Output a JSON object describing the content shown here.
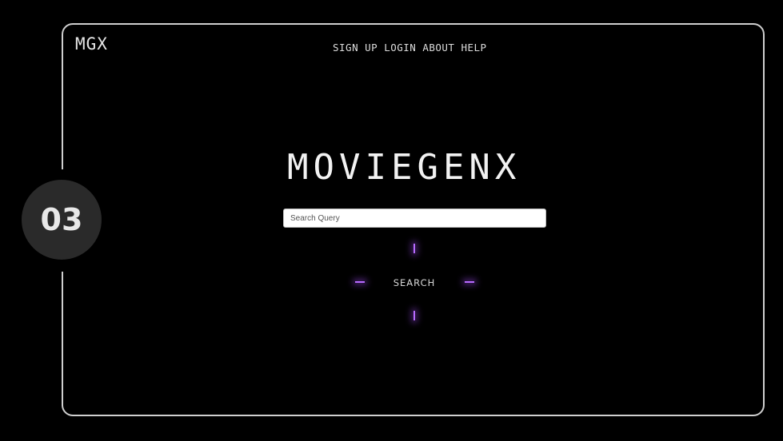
{
  "step_badge": "03",
  "header": {
    "logo": "MGX",
    "nav": {
      "sign_up": "SIGN UP",
      "login": "LOGIN",
      "about": "ABOUT",
      "help": "HELP"
    }
  },
  "main": {
    "title": "MOVIEGENX",
    "search": {
      "placeholder": "Search Query",
      "value": ""
    },
    "search_button": "SEARCH"
  },
  "colors": {
    "background": "#000000",
    "frame": "#cfcfcf",
    "accent_glow": "#b86bff",
    "badge": "#2a2a2a"
  }
}
